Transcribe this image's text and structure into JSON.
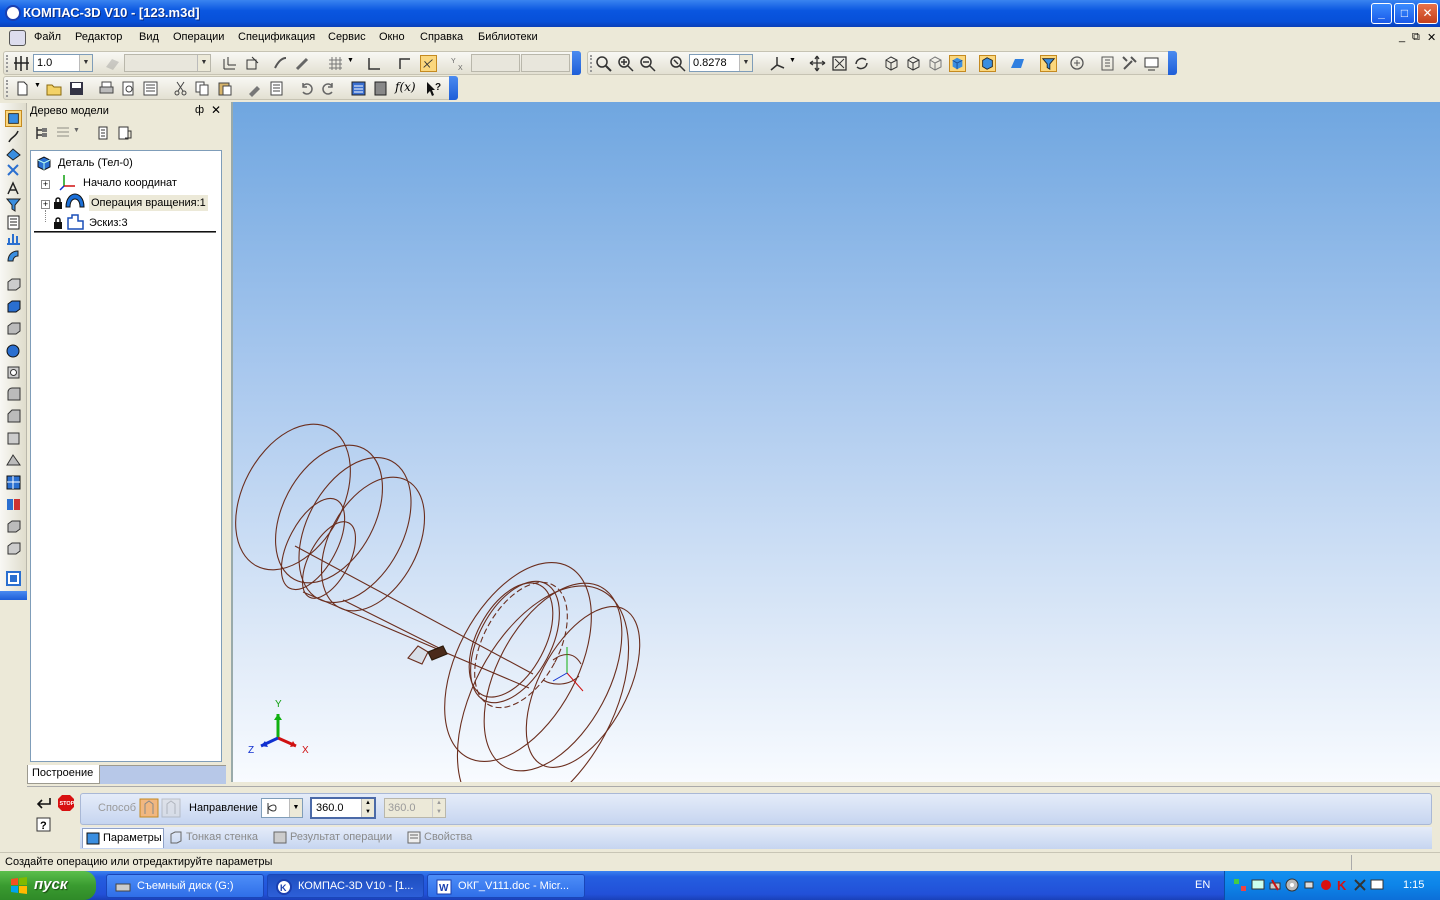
{
  "window": {
    "title": "КОМПАС-3D V10 - [123.m3d]",
    "min_label": "_",
    "max_label": "□",
    "close_label": "✕"
  },
  "menu": {
    "items": [
      "Файл",
      "Редактор",
      "Вид",
      "Операции",
      "Спецификация",
      "Сервис",
      "Окно",
      "Справка",
      "Библиотеки"
    ],
    "mdi_min": "_",
    "mdi_restore": "⧉",
    "mdi_close": "✕"
  },
  "toolbar1": {
    "step_value": "1.0",
    "zoom_value": "0.8278"
  },
  "tree": {
    "title": "Дерево модели",
    "pin": "ф",
    "close": "✕",
    "nodes": [
      {
        "label": "Деталь (Тел-0)"
      },
      {
        "label": "Начало координат"
      },
      {
        "label": "Операция вращения:1"
      },
      {
        "label": "Эскиз:3"
      }
    ],
    "tab_label": "Построение"
  },
  "viewport": {
    "axis_x": "X",
    "axis_y": "Y",
    "axis_z": "Z",
    "colors": {
      "wire": "#6b2e1e",
      "axis_x": "#d01010",
      "axis_y": "#10b010",
      "axis_z": "#1030d0"
    }
  },
  "props": {
    "method_label": "Способ",
    "direction_label": "Направление",
    "angle1": "360.0",
    "angle2": "360.0",
    "tabs": [
      "Параметры",
      "Тонкая стенка",
      "Результат операции",
      "Свойства"
    ]
  },
  "status": {
    "message": "Создайте операцию или отредактируйте параметры"
  },
  "taskbar": {
    "start_label": "пуск",
    "tasks": [
      "Съемный диск (G:)",
      "КОМПАС-3D V10 - [1...",
      "ОКГ_V111.doc - Micr..."
    ],
    "lang": "EN",
    "clock": "1:15"
  }
}
